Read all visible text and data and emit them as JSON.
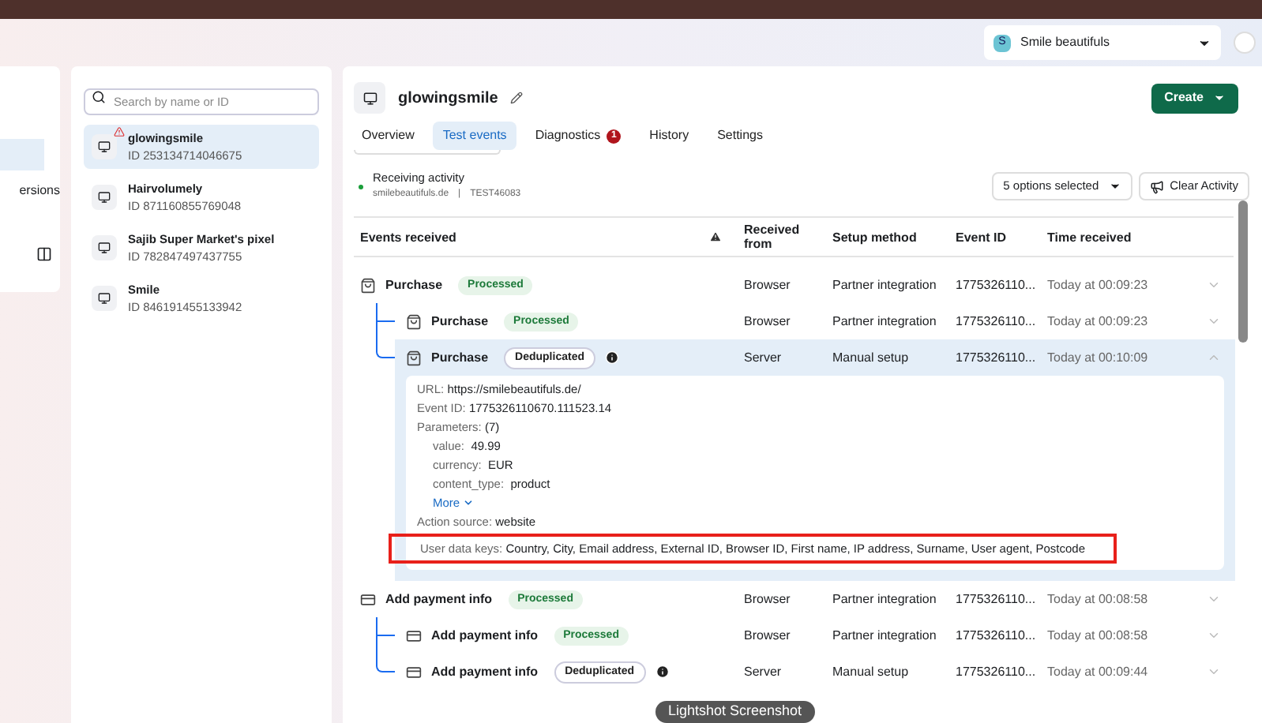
{
  "account_selector": {
    "initial": "S",
    "name": "Smile beautifuls"
  },
  "left_panel": {
    "item_text": "ersions"
  },
  "pixel_list": {
    "search": {
      "placeholder": "Search by name or ID"
    },
    "items": [
      {
        "name": "glowingsmile",
        "id": "ID 253134714046675",
        "selected": true,
        "warning": true
      },
      {
        "name": "Hairvolumely",
        "id": "ID 871160855769048",
        "selected": false,
        "warning": false
      },
      {
        "name": "Sajib Super Market's pixel",
        "id": "ID 782847497437755",
        "selected": false,
        "warning": false
      },
      {
        "name": "Smile",
        "id": "ID 846191455133942",
        "selected": false,
        "warning": false
      }
    ]
  },
  "header": {
    "title": "glowingsmile",
    "create_button": "Create"
  },
  "tabs": [
    {
      "label": "Overview",
      "selected": false
    },
    {
      "label": "Test events",
      "selected": true
    },
    {
      "label": "Diagnostics",
      "selected": false,
      "badge": "1"
    },
    {
      "label": "History",
      "selected": false
    },
    {
      "label": "Settings",
      "selected": false
    }
  ],
  "activity": {
    "status": "Receiving activity",
    "domain": "smilebeautifuls.de",
    "separator": "|",
    "test_code": "TEST46083",
    "filter": "5 options selected",
    "clear_button": "Clear Activity"
  },
  "table": {
    "columns": [
      "Events received",
      "Received from",
      "Setup method",
      "Event ID",
      "Time received"
    ],
    "rows": [
      {
        "name": "Purchase",
        "kind": "cart",
        "status": "Processed",
        "deduplicated": false,
        "received_from": "Browser",
        "setup_method": "Partner integration",
        "event_id": "1775326110...",
        "time": "Today at 00:09:23",
        "expanded": false,
        "children": [
          {
            "name": "Purchase",
            "kind": "cart",
            "status": "Processed",
            "deduplicated": false,
            "received_from": "Browser",
            "setup_method": "Partner integration",
            "event_id": "1775326110...",
            "time": "Today at 00:09:23",
            "expanded": false
          },
          {
            "name": "Purchase",
            "kind": "cart",
            "status": "Deduplicated",
            "deduplicated": true,
            "received_from": "Server",
            "setup_method": "Manual setup",
            "event_id": "1775326110...",
            "time": "Today at 00:10:09",
            "expanded": true,
            "details": {
              "url_label": "URL:",
              "url": "https://smilebeautifuls.de/",
              "event_id_label": "Event ID:",
              "event_id": "1775326110670.111523.14",
              "parameters_label": "Parameters:",
              "parameters_count": "(7)",
              "parameters": [
                {
                  "key": "value:",
                  "value": "49.99"
                },
                {
                  "key": "currency:",
                  "value": "EUR"
                },
                {
                  "key": "content_type:",
                  "value": "product"
                }
              ],
              "more": "More",
              "action_source_label": "Action source:",
              "action_source": "website",
              "user_data_label": "User data keys:",
              "user_data": "Country, City, Email address, External ID, Browser ID, First name, IP address, Surname, User agent, Postcode",
              "highlighted": true
            }
          }
        ]
      },
      {
        "name": "Add payment info",
        "kind": "card",
        "status": "Processed",
        "deduplicated": false,
        "received_from": "Browser",
        "setup_method": "Partner integration",
        "event_id": "1775326110...",
        "time": "Today at 00:08:58",
        "expanded": false,
        "children": [
          {
            "name": "Add payment info",
            "kind": "card",
            "status": "Processed",
            "deduplicated": false,
            "received_from": "Browser",
            "setup_method": "Partner integration",
            "event_id": "1775326110...",
            "time": "Today at 00:08:58",
            "expanded": false
          },
          {
            "name": "Add payment info",
            "kind": "card",
            "status": "Deduplicated",
            "deduplicated": true,
            "received_from": "Server",
            "setup_method": "Manual setup",
            "event_id": "1775326110...",
            "time": "Today at 00:09:44",
            "expanded": false
          }
        ]
      }
    ]
  },
  "tooltip": "Lightshot Screenshot"
}
